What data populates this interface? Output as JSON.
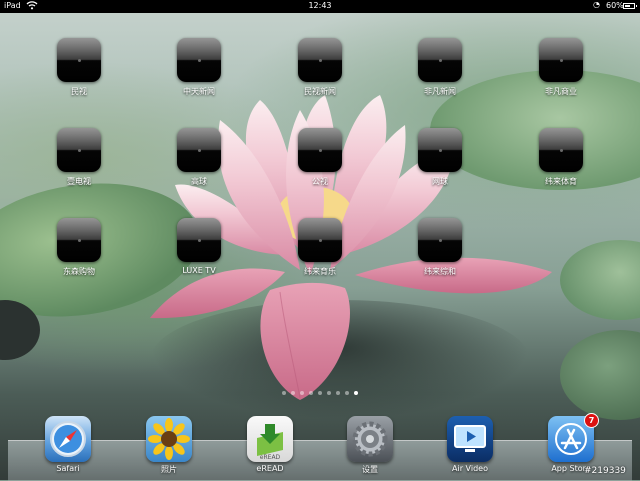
{
  "status_bar": {
    "carrier": "iPad",
    "time": "12:43",
    "battery_percent": "60%",
    "battery_level": 0.6
  },
  "home_apps": [
    {
      "label": "民视"
    },
    {
      "label": "中天新闻"
    },
    {
      "label": "民视新闻"
    },
    {
      "label": "非凡新闻"
    },
    {
      "label": "非凡商业"
    },
    {
      "label": "壹电视"
    },
    {
      "label": "高球"
    },
    {
      "label": "公视"
    },
    {
      "label": "网球"
    },
    {
      "label": "纬来体育"
    },
    {
      "label": "东森购物"
    },
    {
      "label": "LUXE TV"
    },
    {
      "label": "纬来育乐"
    },
    {
      "label": "纬来综和"
    }
  ],
  "page_indicator": {
    "total": 9,
    "current": 9
  },
  "dock": [
    {
      "label": "Safari",
      "icon": "compass-icon"
    },
    {
      "label": "照片",
      "icon": "sunflower-icon"
    },
    {
      "label": "eREAD",
      "icon": "book-arrow-icon"
    },
    {
      "label": "设置",
      "icon": "gear-icon"
    },
    {
      "label": "Air Video",
      "icon": "tv-screen-icon"
    },
    {
      "label": "App Store",
      "icon": "app-store-icon",
      "badge": "7"
    }
  ],
  "watermark": "#219339"
}
